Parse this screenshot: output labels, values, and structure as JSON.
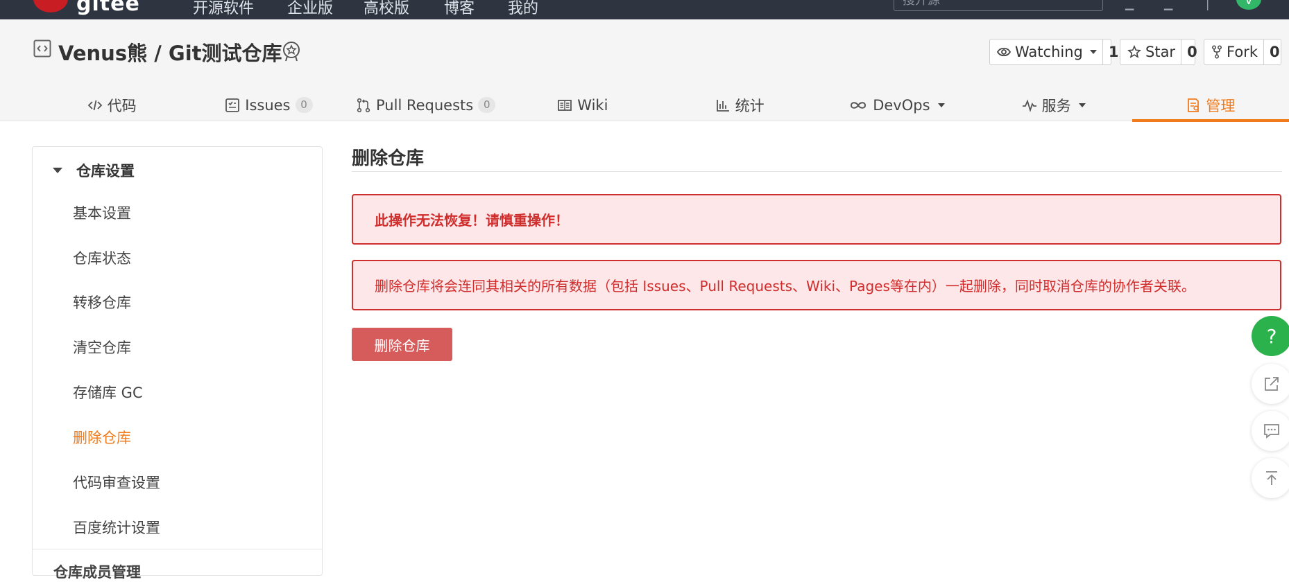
{
  "topnav": {
    "logo_text": "gitee",
    "links": [
      "开源软件",
      "企业版",
      "高校版",
      "博客",
      "我的"
    ],
    "search_placeholder": "搜开源",
    "avatar_initial": "V"
  },
  "project": {
    "owner": "Venus熊",
    "separator": " / ",
    "name": "Git测试仓库",
    "actions": {
      "watch_label": "Watching",
      "watch_count": "1",
      "star_label": "Star",
      "star_count": "0",
      "fork_label": "Fork",
      "fork_count": "0"
    },
    "tabs": [
      {
        "label": "代码",
        "icon": "code-icon"
      },
      {
        "label": "Issues",
        "icon": "issues-icon",
        "count": "0"
      },
      {
        "label": "Pull Requests",
        "icon": "pull-request-icon",
        "count": "0"
      },
      {
        "label": "Wiki",
        "icon": "wiki-book-icon"
      },
      {
        "label": "统计",
        "icon": "stats-chart-icon"
      },
      {
        "label": "DevOps",
        "icon": "infinity-icon"
      },
      {
        "label": "服务",
        "icon": "pulse-icon"
      },
      {
        "label": "管理",
        "icon": "manage-doc-icon"
      }
    ],
    "active_tab": "管理"
  },
  "sidebar": {
    "section_title": "仓库设置",
    "items": [
      "基本设置",
      "仓库状态",
      "转移仓库",
      "清空仓库",
      "存储库 GC",
      "删除仓库",
      "代码审查设置",
      "百度统计设置"
    ],
    "active_item": "删除仓库",
    "next_section": "仓库成员管理"
  },
  "main": {
    "title": "删除仓库",
    "warning": "此操作无法恢复！请慎重操作！",
    "description": "删除仓库将会连同其相关的所有数据（包括 Issues、Pull Requests、Wiki、Pages等在内）一起删除，同时取消仓库的协作者关联。",
    "delete_button": "删除仓库"
  },
  "float": {
    "help_label": "?"
  },
  "colors": {
    "accent": "#f07b1d",
    "danger": "#d65c5c",
    "alert_bg": "#fde7e8",
    "alert_border": "#cf2e2e",
    "topnav_bg": "#2e3440",
    "help_green": "#2bb24c"
  }
}
